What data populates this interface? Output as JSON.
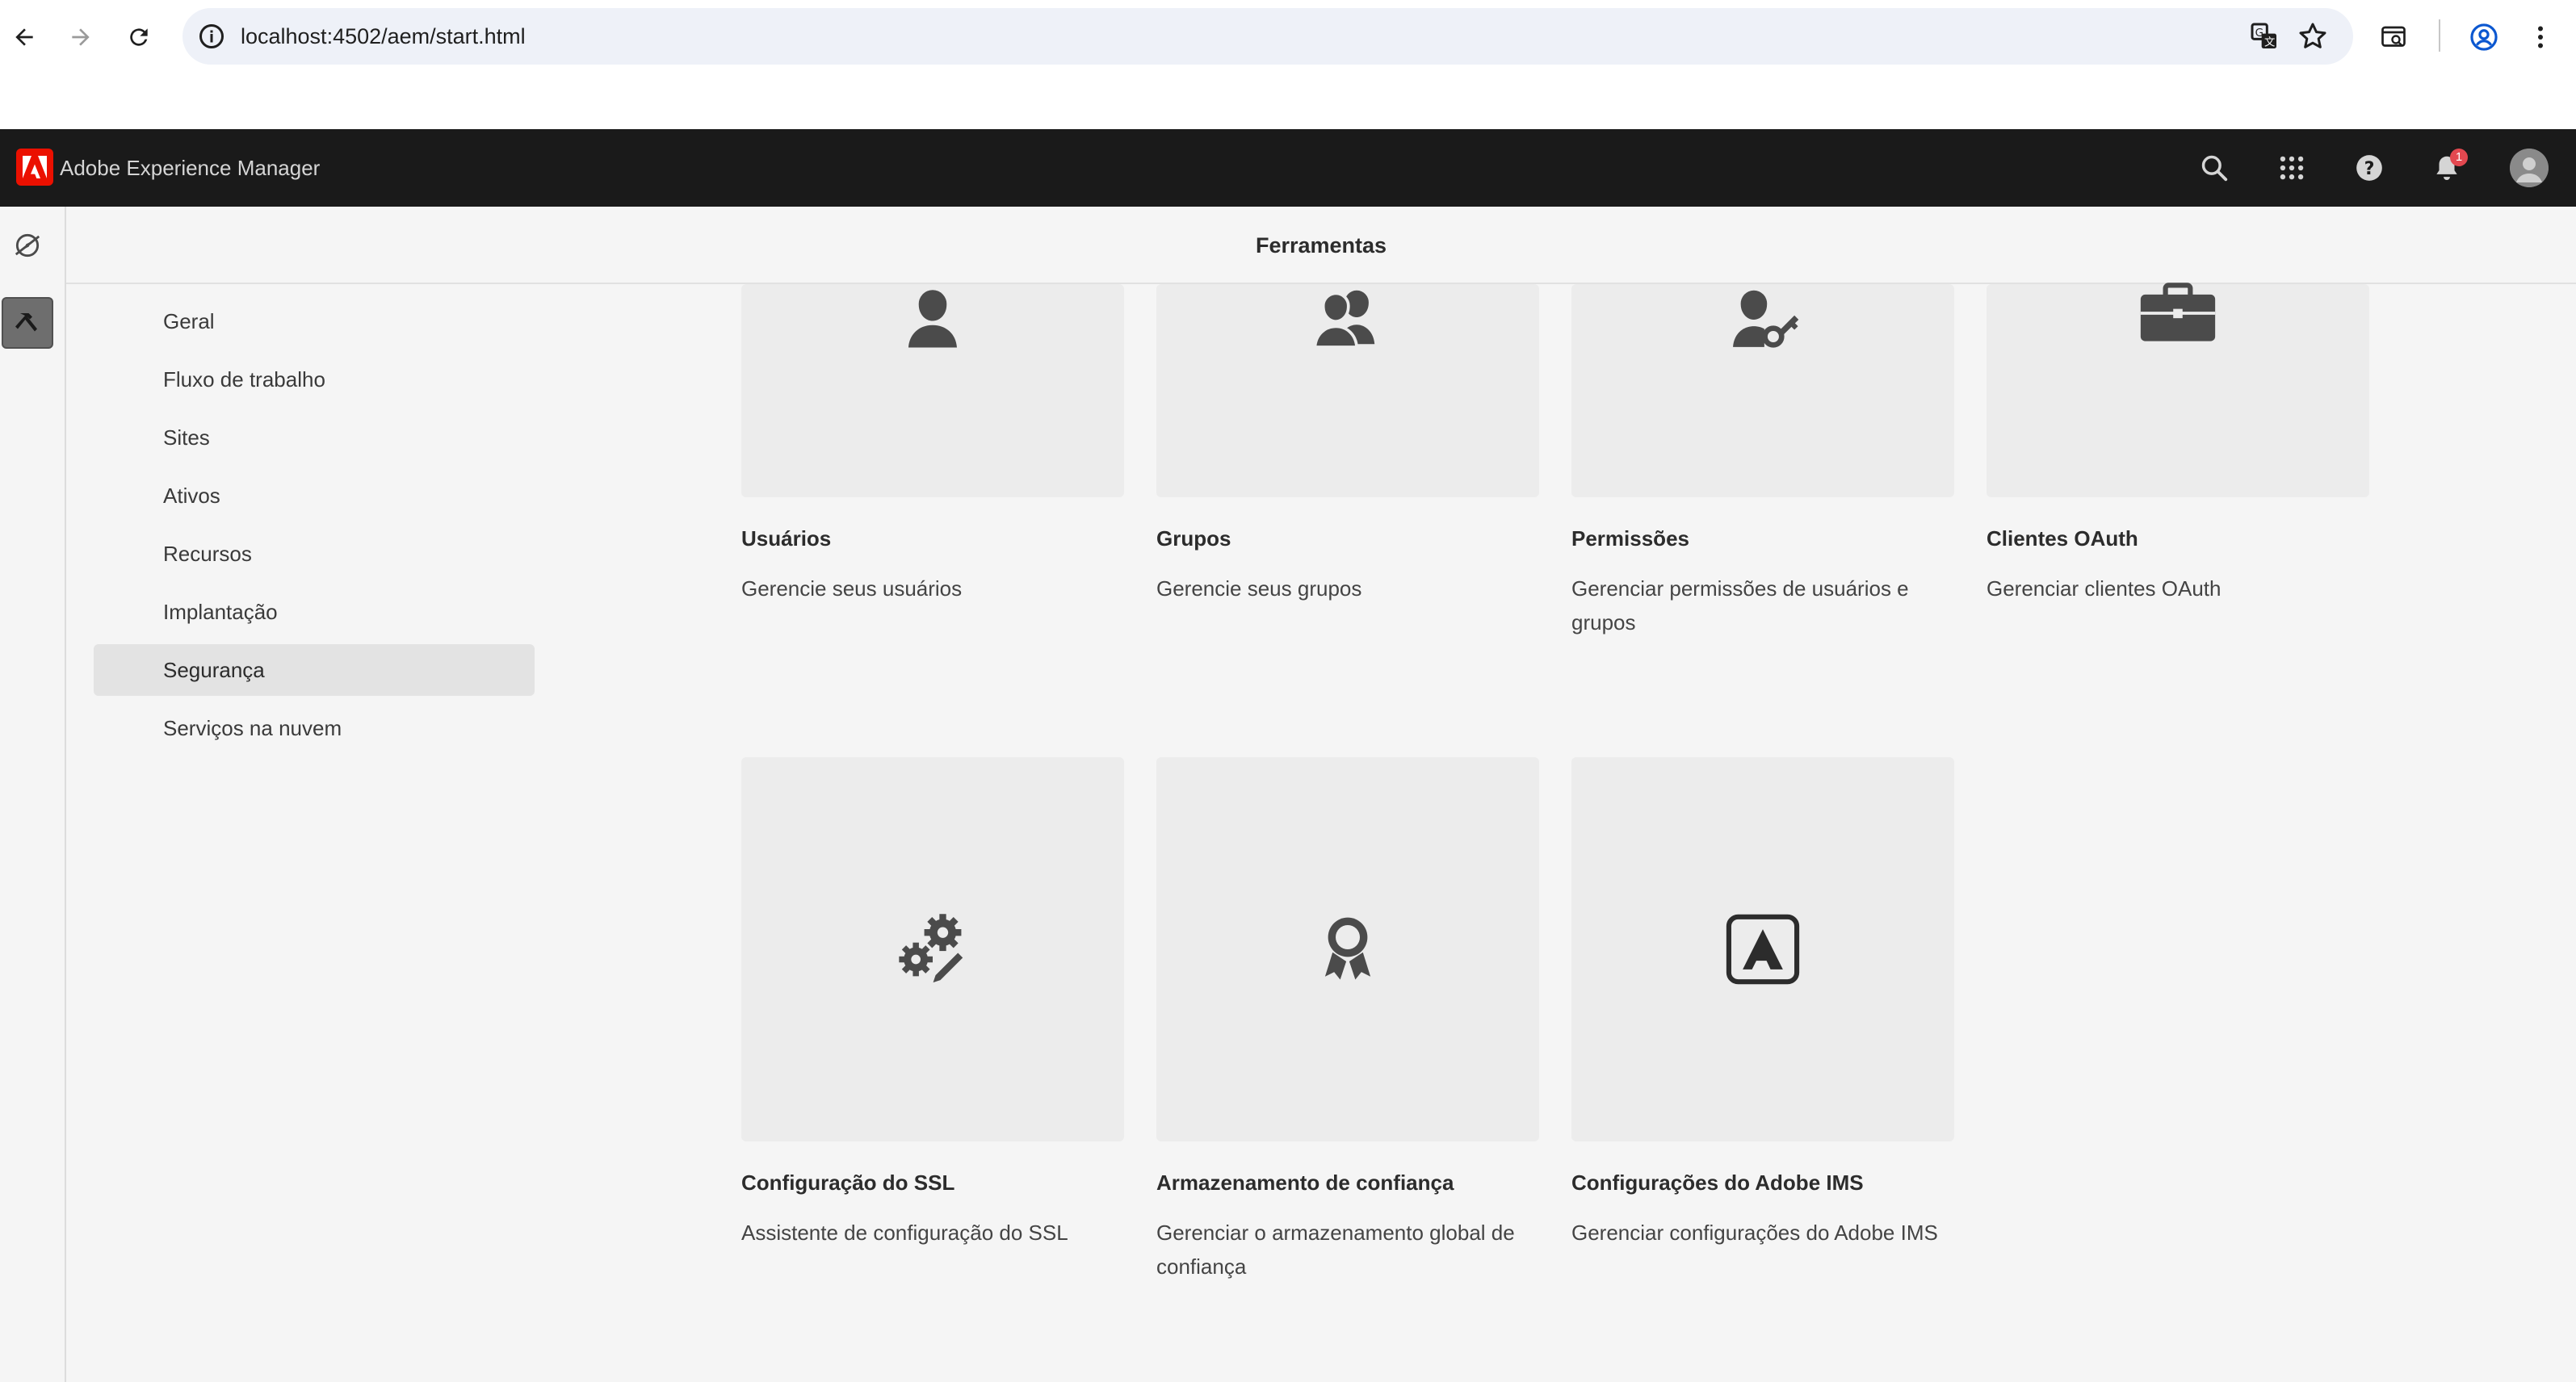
{
  "browser": {
    "url": "localhost:4502/aem/start.html"
  },
  "shell": {
    "app_title": "Adobe Experience Manager",
    "notification_count": "1",
    "brand_color": "#eb1000"
  },
  "page": {
    "title": "Ferramentas"
  },
  "sidebar": {
    "items": [
      {
        "label": "Geral"
      },
      {
        "label": "Fluxo de trabalho"
      },
      {
        "label": "Sites"
      },
      {
        "label": "Ativos"
      },
      {
        "label": "Recursos"
      },
      {
        "label": "Implantação"
      },
      {
        "label": "Segurança",
        "selected": true
      },
      {
        "label": "Serviços na nuvem"
      }
    ]
  },
  "cards": [
    {
      "title": "Usuários",
      "desc": "Gerencie seus usuários",
      "icon": "user-icon"
    },
    {
      "title": "Grupos",
      "desc": "Gerencie seus grupos",
      "icon": "users-group-icon"
    },
    {
      "title": "Permissões",
      "desc": "Gerenciar permissões de usuários e grupos",
      "icon": "user-key-icon"
    },
    {
      "title": "Clientes OAuth",
      "desc": "Gerenciar clientes OAuth",
      "icon": "briefcase-icon"
    },
    {
      "title": "Configuração do SSL",
      "desc": "Assistente de configuração do SSL",
      "icon": "gears-pencil-icon"
    },
    {
      "title": "Armazenamento de confiança",
      "desc": "Gerenciar o armazenamento global de confiança",
      "icon": "ribbon-award-icon"
    },
    {
      "title": "Configurações do Adobe IMS",
      "desc": "Gerenciar configurações do Adobe IMS",
      "icon": "adobe-logo-icon"
    }
  ]
}
